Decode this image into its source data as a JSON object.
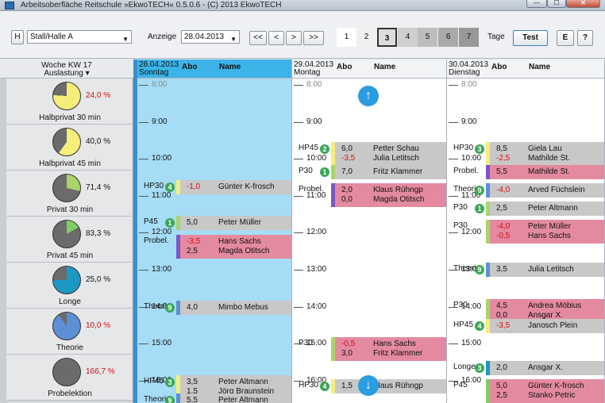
{
  "window": {
    "title": "Arbeitsoberfläche Reitschule »EkwoTECH« 0.5.0.6 - (C) 2013 EkwoTECH",
    "min": "—",
    "max": "☐",
    "close": "✕"
  },
  "toolbar": {
    "h_btn": "H",
    "stall": "Stall/Halle A",
    "anzeige_label": "Anzeige",
    "date": "28.04.2013",
    "nav": [
      "<<",
      "<",
      ">",
      ">>"
    ],
    "days": [
      "1",
      "2",
      "3",
      "4",
      "5",
      "6",
      "7"
    ],
    "tage_label": "Tage",
    "test_btn": "Test",
    "e_btn": "E",
    "help_btn": "?"
  },
  "stats": {
    "week": "Woche KW 17",
    "mode": "Auslastung",
    "items": [
      {
        "label": "Halbprivat 30 min",
        "pct": "24,0 %",
        "value": 24.0,
        "red": true,
        "color": "#f6ee7a"
      },
      {
        "label": "Halbprivat 45 min",
        "pct": "40,0 %",
        "value": 40.0,
        "red": false,
        "color": "#f6ee7a"
      },
      {
        "label": "Privat 30 min",
        "pct": "71,4 %",
        "value": 71.4,
        "red": false,
        "color": "#a8d46a"
      },
      {
        "label": "Privat 45 min",
        "pct": "83,3 %",
        "value": 83.3,
        "red": false,
        "color": "#7ecf62"
      },
      {
        "label": "Longe",
        "pct": "25,0 %",
        "value": 25.0,
        "red": false,
        "color": "#1b98c4"
      },
      {
        "label": "Theorie",
        "pct": "10,0 %",
        "value": 10.0,
        "red": true,
        "color": "#5d8fd4"
      },
      {
        "label": "Probelektion",
        "pct": "166,7 %",
        "value": 166.7,
        "red": true,
        "color": "#8a4fc8"
      }
    ]
  },
  "days": [
    {
      "date": "28.04.2013",
      "weekday": "Sonntag",
      "abo": "Abo",
      "name": "Name",
      "hours": [
        "8:00",
        "9:00",
        "10:00",
        "11:00",
        "12:00",
        "13:00",
        "14:00",
        "15:00",
        "16:00"
      ],
      "lessons": [
        {
          "type": "HP30",
          "num": "4",
          "rows": [
            [
              "-1,0",
              "Günter K-frosch"
            ]
          ],
          "reds": [
            true
          ],
          "bg": "#c8c8c8",
          "bar": "#f6ee7a",
          "typey": 156
        },
        {
          "type": "P45",
          "num": "1",
          "rows": [
            [
              "5,0",
              "Peter Müller"
            ]
          ],
          "reds": [
            false
          ],
          "bg": "#c8c8c8",
          "bar": "#a8d46a",
          "typey": 201
        },
        {
          "type": "Probel.",
          "num": "",
          "rows": [
            [
              "-3,5",
              "Hans Sachs"
            ],
            [
              "2,5",
              "Magda Otitsch"
            ]
          ],
          "reds": [
            true,
            false
          ],
          "bg": "#e48aa0",
          "bar": "#7a55c8",
          "typey": 225
        },
        {
          "type": "Theorie",
          "num": "9",
          "rows": [
            [
              "4,0",
              "Mimbo Mebus"
            ]
          ],
          "reds": [
            false
          ],
          "bg": "#c8c8c8",
          "bar": "#5d8fd4",
          "typey": 308
        },
        {
          "type": "HP45",
          "num": "3",
          "rows": [
            [
              "3,5",
              "Peter Altmann"
            ],
            [
              "1,5",
              "Jörg Braunstein"
            ]
          ],
          "reds": [
            false,
            false
          ],
          "bg": "#c8c8c8",
          "bar": "#f6ee7a",
          "typey": 402
        },
        {
          "type": "Theorie",
          "num": "9",
          "rows": [
            [
              "5,5",
              "Peter Altmann"
            ]
          ],
          "reds": [
            false
          ],
          "bg": "#c8c8c8",
          "bar": "#5d8fd4",
          "typey": 425
        }
      ]
    },
    {
      "date": "29.04.2013",
      "weekday": "Montag",
      "abo": "Abo",
      "name": "Name",
      "hours": [
        "8:00",
        "9:00",
        "10:00",
        "11:00",
        "12:00",
        "13:00",
        "14:00",
        "15:00",
        "16:00"
      ],
      "lessons": [
        {
          "type": "HP45",
          "num": "2",
          "rows": [
            [
              "6,0",
              "Petter Schau"
            ],
            [
              "-3,5",
              "Julia Letitsch"
            ]
          ],
          "reds": [
            false,
            true
          ],
          "bg": "#c8c8c8",
          "bar": "#f6ee7a",
          "typey": 108
        },
        {
          "type": "P30",
          "num": "1",
          "rows": [
            [
              "7,0",
              "Fritz Klammer"
            ]
          ],
          "reds": [
            false
          ],
          "bg": "#c8c8c8",
          "bar": "#a8d46a",
          "typey": 137
        },
        {
          "type": "Probel.",
          "num": "",
          "rows": [
            [
              "2,0",
              "Klaus Rühngp"
            ],
            [
              "0,0",
              "Magda Otitsch"
            ]
          ],
          "reds": [
            false,
            false
          ],
          "bg": "#e48aa0",
          "bar": "#7a55c8",
          "typey": 160
        },
        {
          "type": "P30",
          "num": "",
          "rows": [
            [
              "-0,5",
              "Hans Sachs"
            ],
            [
              "3,0",
              "Fritz Klammer"
            ]
          ],
          "reds": [
            true,
            false
          ],
          "bg": "#e48aa0",
          "bar": "#a8d46a",
          "typey": 354
        },
        {
          "type": "HP30",
          "num": "4",
          "rows": [
            [
              "1,5",
              "Klaus Rühngp"
            ]
          ],
          "reds": [
            false
          ],
          "bg": "#c8c8c8",
          "bar": "#f6ee7a",
          "typey": 407
        }
      ]
    },
    {
      "date": "30.04.2013",
      "weekday": "Dienstag",
      "abo": "Abo",
      "name": "Name",
      "hours": [
        "8:00",
        "9:00",
        "10:00",
        "11:00",
        "12:00",
        "13:00",
        "14:00",
        "15:00",
        "16:00"
      ],
      "lessons": [
        {
          "type": "HP30",
          "num": "3",
          "rows": [
            [
              "8,5",
              "Giela Lau"
            ],
            [
              "-2,5",
              "Mathilde St."
            ]
          ],
          "reds": [
            false,
            true
          ],
          "bg": "#c8c8c8",
          "bar": "#f6ee7a",
          "typey": 108
        },
        {
          "type": "Probel.",
          "num": "",
          "rows": [
            [
              "5,5",
              "Mathilde St."
            ]
          ],
          "reds": [
            false
          ],
          "bg": "#e48aa0",
          "bar": "#7a55c8",
          "typey": 137
        },
        {
          "type": "Theorie",
          "num": "9",
          "rows": [
            [
              "-4,0",
              "Arved Füchslein"
            ]
          ],
          "reds": [
            true
          ],
          "bg": "#c8c8c8",
          "bar": "#5d8fd4",
          "typey": 160
        },
        {
          "type": "P30",
          "num": "1",
          "rows": [
            [
              "2,5",
              "Peter Altmann"
            ]
          ],
          "reds": [
            false
          ],
          "bg": "#c8c8c8",
          "bar": "#a8d46a",
          "typey": 183
        },
        {
          "type": "P30",
          "num": "",
          "rows": [
            [
              "-4,0",
              "Peter Müller"
            ],
            [
              "-0,5",
              "Hans Sachs"
            ]
          ],
          "reds": [
            true,
            true
          ],
          "bg": "#e48aa0",
          "bar": "#a8d46a",
          "typey": 206
        },
        {
          "type": "Theorie",
          "num": "9",
          "rows": [
            [
              "3,5",
              "Julia Letitsch"
            ]
          ],
          "reds": [
            false
          ],
          "bg": "#c8c8c8",
          "bar": "#5d8fd4",
          "typey": 260
        },
        {
          "type": "P30",
          "num": "",
          "rows": [
            [
              "4,5",
              "Andrea Möbius"
            ],
            [
              "0,0",
              "Ansgar X."
            ]
          ],
          "reds": [
            false,
            false
          ],
          "bg": "#e48aa0",
          "bar": "#a8d46a",
          "typey": 306
        },
        {
          "type": "HP45",
          "num": "4",
          "rows": [
            [
              "-3,5",
              "Janosch Plein"
            ]
          ],
          "reds": [
            true
          ],
          "bg": "#c8c8c8",
          "bar": "#f6ee7a",
          "typey": 331
        },
        {
          "type": "Longe",
          "num": "3",
          "rows": [
            [
              "2,0",
              "Ansgar X."
            ]
          ],
          "reds": [
            false
          ],
          "bg": "#c8c8c8",
          "bar": "#1b98c4",
          "typey": 384
        },
        {
          "type": "P45",
          "num": "",
          "rows": [
            [
              "5,0",
              "Günter K-frosch"
            ],
            [
              "2,5",
              "Stanko Petric"
            ]
          ],
          "reds": [
            false,
            false
          ],
          "bg": "#e48aa0",
          "bar": "#7ecf62",
          "typey": 407
        }
      ]
    }
  ]
}
